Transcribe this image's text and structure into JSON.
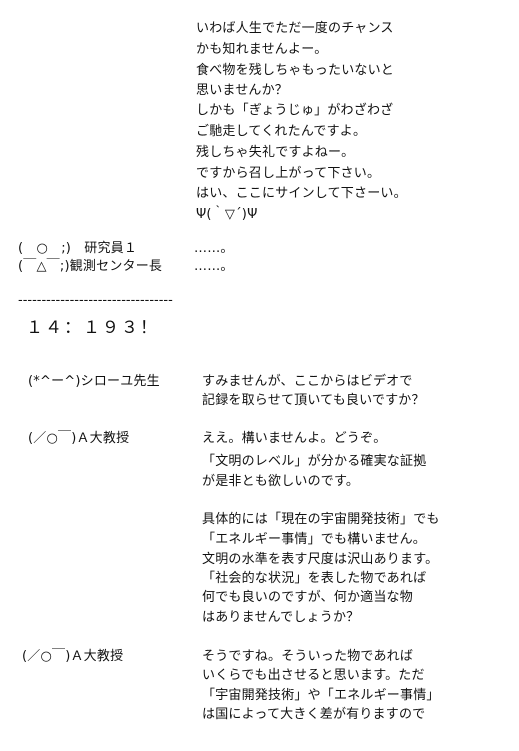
{
  "intro_lines": [
    "いわば人生でただ一度のチャンス",
    "かも知れませんよー。",
    "食べ物を残しちゃもったいないと",
    "思いませんか？",
    "しかも「ぎょうじゅ」がわざわざ",
    "ご馳走してくれたんですよ。",
    "残しちゃ失礼ですよねー。",
    "ですから召し上がって下さい。",
    "はい、ここにサインして下さーい。",
    "Ψ(｀▽´)Ψ"
  ],
  "lab_lines": [
    {
      "speaker": "(　○　;)　研究員１",
      "text": "……。"
    },
    {
      "speaker": "(￣△￣;)観測センター長",
      "text": "……。"
    }
  ],
  "separator": "---------------------------------",
  "timestamp": "１４：１９３！",
  "dialogue": [
    {
      "speaker": "(*^ー^)シローユ先生",
      "lines": [
        "すみませんが、ここからはビデオで",
        "記録を取らせて頂いても良いですか？"
      ]
    },
    {
      "speaker": "(／○￣)Ａ大教授",
      "lines": [
        "ええ。構いませんよ。どうぞ。",
        "「文明のレベル」が分かる確実な証拠",
        "が是非とも欲しいのです。",
        "",
        "具体的には「現在の宇宙開発技術」でも",
        "「エネルギー事情」でも構いません。",
        "文明の水準を表す尺度は沢山あります。",
        "「社会的な状況」を表した物であれば",
        "何でも良いのですが、何か適当な物",
        "はありませんでしょうか？"
      ]
    },
    {
      "speaker": "(／○￣)Ａ大教授",
      "lines": [
        "そうですね。そういった物であれば",
        "いくらでも出させると思います。ただ",
        "「宇宙開発技術」や「エネルギー事情」",
        "は国によって大きく差が有りますので"
      ]
    }
  ]
}
